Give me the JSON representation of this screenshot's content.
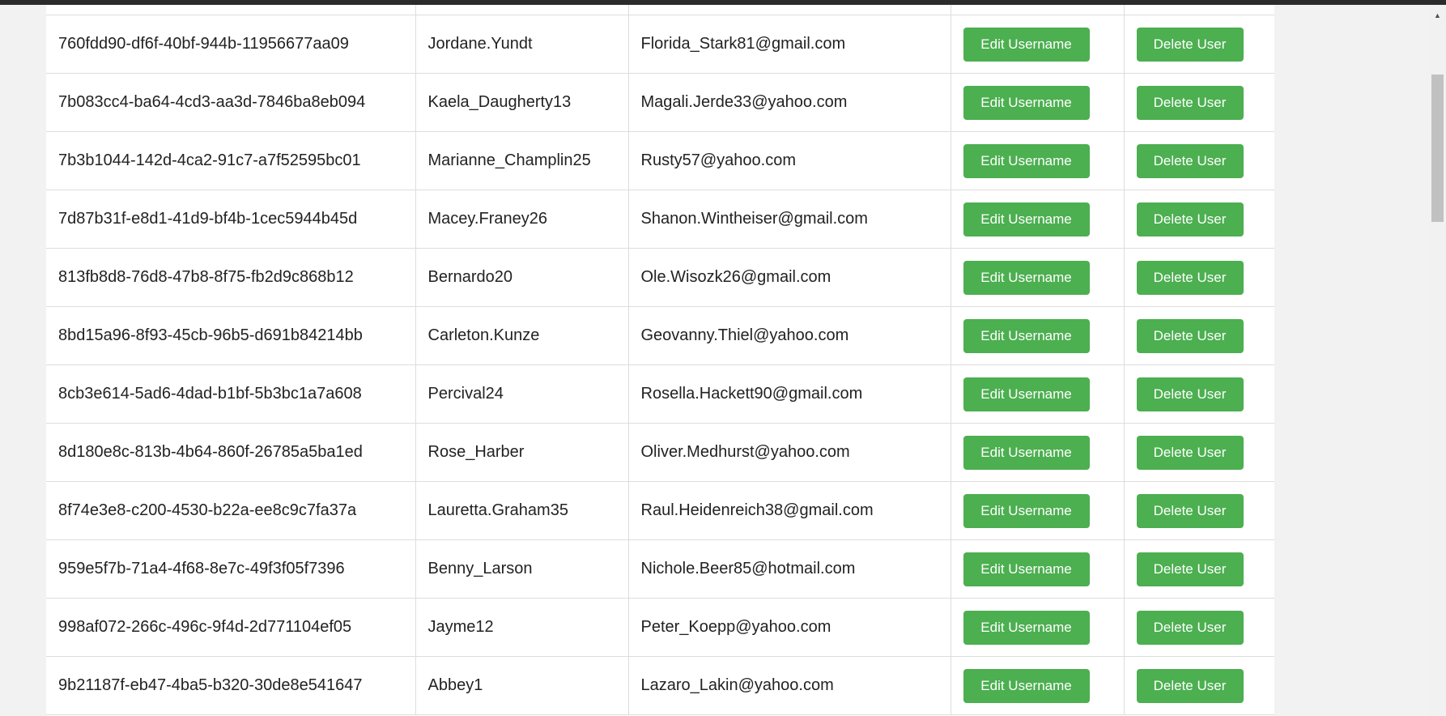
{
  "users": [
    {
      "id": "760fdd90-df6f-40bf-944b-11956677aa09",
      "username": "Jordane.Yundt",
      "email": "Florida_Stark81@gmail.com"
    },
    {
      "id": "7b083cc4-ba64-4cd3-aa3d-7846ba8eb094",
      "username": "Kaela_Daugherty13",
      "email": "Magali.Jerde33@yahoo.com"
    },
    {
      "id": "7b3b1044-142d-4ca2-91c7-a7f52595bc01",
      "username": "Marianne_Champlin25",
      "email": "Rusty57@yahoo.com"
    },
    {
      "id": "7d87b31f-e8d1-41d9-bf4b-1cec5944b45d",
      "username": "Macey.Franey26",
      "email": "Shanon.Wintheiser@gmail.com"
    },
    {
      "id": "813fb8d8-76d8-47b8-8f75-fb2d9c868b12",
      "username": "Bernardo20",
      "email": "Ole.Wisozk26@gmail.com"
    },
    {
      "id": "8bd15a96-8f93-45cb-96b5-d691b84214bb",
      "username": "Carleton.Kunze",
      "email": "Geovanny.Thiel@yahoo.com"
    },
    {
      "id": "8cb3e614-5ad6-4dad-b1bf-5b3bc1a7a608",
      "username": "Percival24",
      "email": "Rosella.Hackett90@gmail.com"
    },
    {
      "id": "8d180e8c-813b-4b64-860f-26785a5ba1ed",
      "username": "Rose_Harber",
      "email": "Oliver.Medhurst@yahoo.com"
    },
    {
      "id": "8f74e3e8-c200-4530-b22a-ee8c9c7fa37a",
      "username": "Lauretta.Graham35",
      "email": "Raul.Heidenreich38@gmail.com"
    },
    {
      "id": "959e5f7b-71a4-4f68-8e7c-49f3f05f7396",
      "username": "Benny_Larson",
      "email": "Nichole.Beer85@hotmail.com"
    },
    {
      "id": "998af072-266c-496c-9f4d-2d771104ef05",
      "username": "Jayme12",
      "email": "Peter_Koepp@yahoo.com"
    },
    {
      "id": "9b21187f-eb47-4ba5-b320-30de8e541647",
      "username": "Abbey1",
      "email": "Lazaro_Lakin@yahoo.com"
    }
  ],
  "actions": {
    "edit_label": "Edit Username",
    "delete_label": "Delete User"
  },
  "colors": {
    "button_bg": "#4caf50",
    "button_text": "#ffffff",
    "grid_line": "#dddddd",
    "page_bg": "#f2f2f2"
  },
  "icons": {
    "scroll_up": "caret-up-icon"
  }
}
